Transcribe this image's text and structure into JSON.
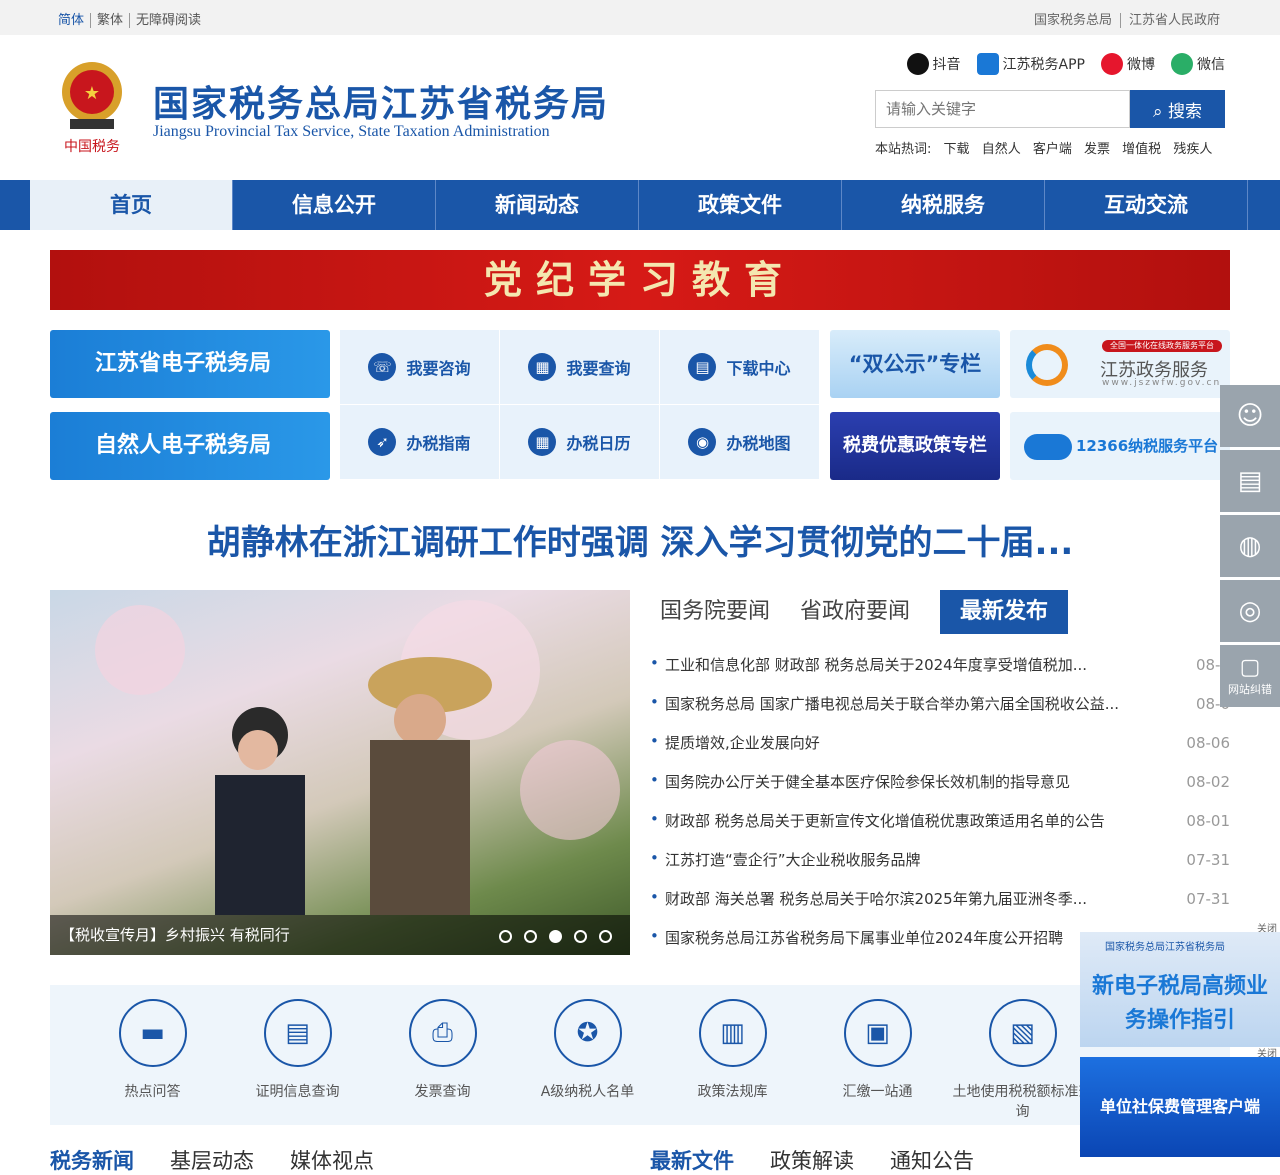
{
  "topbar": {
    "simplified": "简体",
    "traditional": "繁体",
    "accessible": "无障碍阅读",
    "link1": "国家税务总局",
    "link2": "江苏省人民政府"
  },
  "header": {
    "title": "国家税务总局江苏省税务局",
    "subtitle": "Jiangsu Provincial Tax Service, State Taxation Administration",
    "emblem_text": "中国税务",
    "socials": [
      "抖音",
      "江苏税务APP",
      "微博",
      "微信"
    ],
    "search_placeholder": "请输入关键字",
    "search_button": "搜索",
    "hot_label": "本站热词:",
    "hot_words": [
      "下载",
      "自然人",
      "客户端",
      "发票",
      "增值税",
      "残疾人"
    ]
  },
  "nav": [
    "首页",
    "信息公开",
    "新闻动态",
    "政策文件",
    "纳税服务",
    "互动交流"
  ],
  "banner": "党纪学习教育",
  "quick": {
    "etax1": "江苏省电子税务局",
    "etax2": "自然人电子税务局",
    "grid": [
      "我要咨询",
      "我要查询",
      "下载中心",
      "办税指南",
      "办税日历",
      "办税地图"
    ],
    "special1": "“双公示”专栏",
    "special2": "税费优惠政策专栏",
    "right1_small": "全国一体化在线政务服务平台",
    "right1": "江苏政务服务",
    "right1_url": "www.jszwfw.gov.cn",
    "right2": "12366纳税服务平台"
  },
  "headline": "胡静林在浙江调研工作时强调 深入学习贯彻党的二十届...",
  "photo_caption": "【税收宣传月】乡村振兴 有税同行",
  "news_tabs": [
    "国务院要闻",
    "省政府要闻",
    "最新发布"
  ],
  "news": [
    {
      "title": "工业和信息化部 财政部 税务总局关于2024年度享受增值税加...",
      "date": "08-0"
    },
    {
      "title": "国家税务总局 国家广播电视总局关于联合举办第六届全国税收公益...",
      "date": "08-0"
    },
    {
      "title": "提质增效,企业发展向好",
      "date": "08-06"
    },
    {
      "title": "国务院办公厅关于健全基本医疗保险参保长效机制的指导意见",
      "date": "08-02"
    },
    {
      "title": "财政部 税务总局关于更新宣传文化增值税优惠政策适用名单的公告",
      "date": "08-01"
    },
    {
      "title": "江苏打造“壹企行”大企业税收服务品牌",
      "date": "07-31"
    },
    {
      "title": "财政部 海关总署 税务总局关于哈尔滨2025年第九届亚洲冬季...",
      "date": "07-31"
    },
    {
      "title": "国家税务总局江苏省税务局下属事业单位2024年度公开招聘",
      "date": ""
    }
  ],
  "services": [
    "热点问答",
    "证明信息查询",
    "发票查询",
    "A级纳税人名单",
    "政策法规库",
    "汇缴一站通",
    "土地使用税税额标准查询"
  ],
  "bottom_tabs_left": [
    "税务新闻",
    "基层动态",
    "媒体视点"
  ],
  "bottom_tabs_right": [
    "最新文件",
    "政策解读",
    "通知公告"
  ],
  "float_last": "网站纠错",
  "ads": {
    "close": "关闭",
    "ad1_top": "国家税务总局江苏省税务局",
    "ad1": "新电子税局高频业务操作指引",
    "ad2": "单位社保费管理客户端"
  }
}
